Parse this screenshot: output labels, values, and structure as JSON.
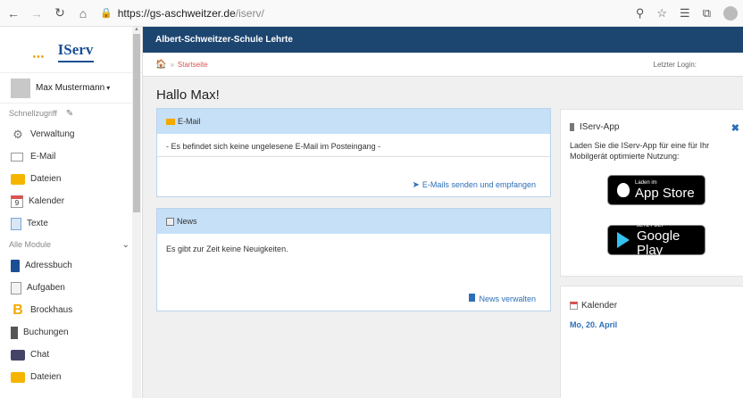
{
  "browser": {
    "url_host": "https://gs-aschweitzer.de",
    "url_path": "/iserv/"
  },
  "sidebar": {
    "logo": "IServ",
    "user_name": "Max Mustermann",
    "section_quick": "Schnellzugriff",
    "quick_items": [
      {
        "label": "Verwaltung",
        "icon": "gear-icon"
      },
      {
        "label": "E-Mail",
        "icon": "mail-icon"
      },
      {
        "label": "Dateien",
        "icon": "folder-icon"
      },
      {
        "label": "Kalender",
        "icon": "calendar-icon",
        "day": "9"
      },
      {
        "label": "Texte",
        "icon": "text-icon"
      }
    ],
    "section_modules": "Alle Module",
    "module_items": [
      {
        "label": "Adressbuch",
        "icon": "addressbook-icon"
      },
      {
        "label": "Aufgaben",
        "icon": "tasks-icon"
      },
      {
        "label": "Brockhaus",
        "icon": "brockhaus-icon",
        "glyph": "B"
      },
      {
        "label": "Buchungen",
        "icon": "bookings-icon"
      },
      {
        "label": "Chat",
        "icon": "chat-icon"
      },
      {
        "label": "Dateien",
        "icon": "folder-icon"
      }
    ]
  },
  "header": {
    "school": "Albert-Schweitzer-Schule Lehrte",
    "breadcrumb": "Startseite",
    "last_login": "Letzter Login:"
  },
  "greeting": "Hallo Max!",
  "email_panel": {
    "title": "E-Mail",
    "message": "- Es befindet sich keine ungelesene E-Mail im Posteingang -",
    "link": "E-Mails senden und empfangen"
  },
  "news_panel": {
    "title": "News",
    "message": "Es gibt zur Zeit keine Neuigkeiten.",
    "link": "News verwalten"
  },
  "app_panel": {
    "title": "IServ-App",
    "text": "Laden Sie die IServ-App für eine für Ihr Mobilgerät optimierte Nutzung:",
    "appstore_small": "Laden im",
    "appstore_big": "App Store",
    "googleplay_small": "JETZT BEI",
    "googleplay_big": "Google Play"
  },
  "calendar_panel": {
    "title": "Kalender",
    "date": "Mo, 20. April"
  }
}
